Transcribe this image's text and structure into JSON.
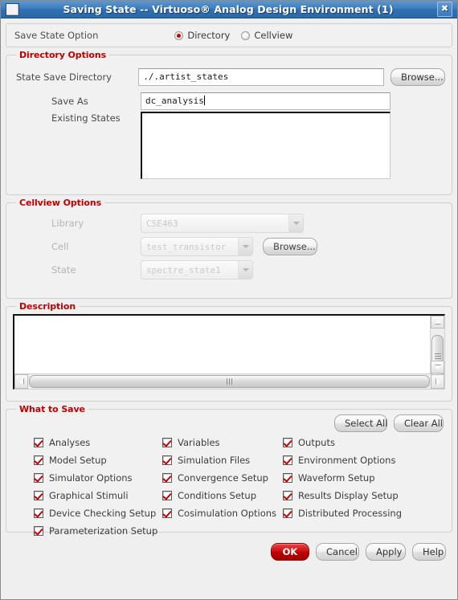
{
  "window": {
    "title": "Saving State -- Virtuoso® Analog Design Environment (1)",
    "close_glyph": "✖"
  },
  "save_state_option": {
    "label": "Save State Option",
    "options": [
      {
        "label": "Directory",
        "selected": true
      },
      {
        "label": "Cellview",
        "selected": false
      }
    ]
  },
  "directory_options": {
    "legend": "Directory Options",
    "state_save_directory_label": "State Save Directory",
    "state_save_directory_value": "./.artist_states",
    "browse_label": "Browse...",
    "save_as_label": "Save As",
    "save_as_value": "dc_analysis",
    "existing_states_label": "Existing States",
    "existing_states_items": []
  },
  "cellview_options": {
    "legend": "Cellview Options",
    "library_label": "Library",
    "library_value": "CSE463",
    "cell_label": "Cell",
    "cell_value": "test_transistor",
    "state_label": "State",
    "state_value": "spectre_state1",
    "browse_label": "Browse..."
  },
  "description": {
    "legend": "Description",
    "value": ""
  },
  "what_to_save": {
    "legend": "What to Save",
    "select_all_label": "Select All",
    "clear_all_label": "Clear All",
    "items": [
      {
        "label": "Analyses",
        "checked": true
      },
      {
        "label": "Variables",
        "checked": true
      },
      {
        "label": "Outputs",
        "checked": true
      },
      {
        "label": "Model Setup",
        "checked": true
      },
      {
        "label": "Simulation Files",
        "checked": true
      },
      {
        "label": "Environment Options",
        "checked": true
      },
      {
        "label": "Simulator Options",
        "checked": true
      },
      {
        "label": "Convergence Setup",
        "checked": true
      },
      {
        "label": "Waveform Setup",
        "checked": true
      },
      {
        "label": "Graphical Stimuli",
        "checked": true
      },
      {
        "label": "Conditions Setup",
        "checked": true
      },
      {
        "label": "Results Display Setup",
        "checked": true
      },
      {
        "label": "Device Checking Setup",
        "checked": true
      },
      {
        "label": "Cosimulation Options",
        "checked": true
      },
      {
        "label": "Distributed Processing",
        "checked": true
      },
      {
        "label": "Parameterization Setup",
        "checked": true
      }
    ]
  },
  "footer": {
    "ok_label": "OK",
    "cancel_label": "Cancel",
    "apply_label": "Apply",
    "help_label": "Help"
  },
  "colors": {
    "legend_red": "#c00000",
    "accent_red": "#c60000",
    "titlebar_blue": "#3d7ebd",
    "ok_red": "#cf1010"
  }
}
